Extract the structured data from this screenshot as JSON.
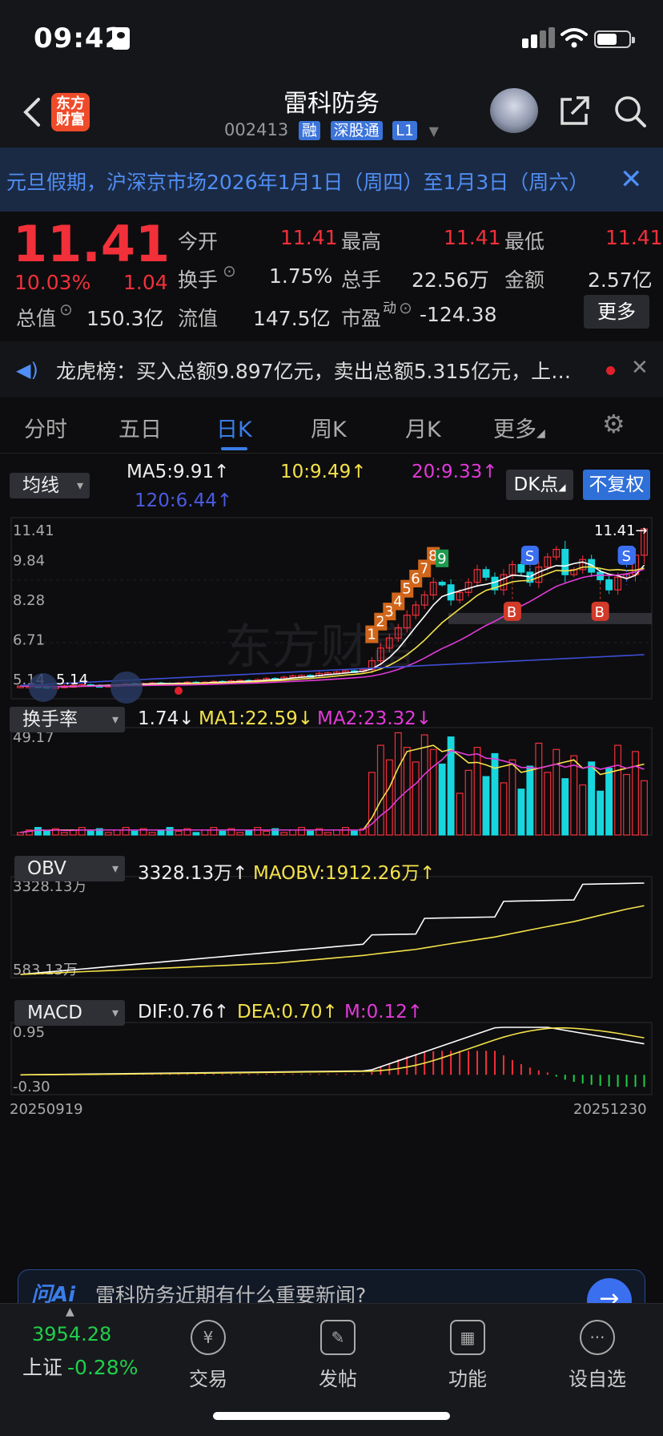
{
  "status_bar": {
    "time": "09:42"
  },
  "header": {
    "logo_text": "东方财富",
    "title": "雷科防务",
    "code": "002413",
    "tags": [
      "融",
      "深股通",
      "L1"
    ]
  },
  "notice": {
    "text": "元旦假期，沪深京市场2026年1月1日（周四）至1月3日（周六）"
  },
  "quote": {
    "price": "11.41",
    "change_pct": "10.03%",
    "change": "1.04",
    "open_label": "今开",
    "open": "11.41",
    "high_label": "最高",
    "high": "11.41",
    "low_label": "最低",
    "low": "11.41",
    "turnover_label": "换手",
    "turnover": "1.75%",
    "volume_label": "总手",
    "volume": "22.56万",
    "amount_label": "金额",
    "amount": "2.57亿",
    "mcap_label": "总值",
    "mcap": "150.3亿",
    "float_label": "流值",
    "float_cap": "147.5亿",
    "pe_label": "市盈",
    "pe_sup": "动",
    "pe": "-124.38",
    "more_label": "更多"
  },
  "dragon_tiger": {
    "text": "龙虎榜：买入总额9.897亿元，卖出总额5.315亿元，上榜原因..."
  },
  "tabs": [
    "分时",
    "五日",
    "日K",
    "周K",
    "月K",
    "更多"
  ],
  "active_tab": "日K",
  "kline": {
    "indicator_select": "均线",
    "ma5": "MA5:9.91↑",
    "ma10": "10:9.49↑",
    "ma20": "20:9.33↑",
    "ma120": "120:6.44↑",
    "dk_label": "DK点",
    "adjust_label": "不复权",
    "y_ticks": [
      "11.41",
      "9.84",
      "8.28",
      "6.71",
      "5.14"
    ],
    "last_label": "11.41",
    "low_marker": "5.14",
    "watermark": "东方财富",
    "signals": [
      "1",
      "2",
      "3",
      "4",
      "5",
      "6",
      "7",
      "8",
      "9"
    ],
    "s_marks": [
      "S",
      "S"
    ],
    "b_marks": [
      "B",
      "B"
    ]
  },
  "turnover": {
    "select": "换手率",
    "value": "1.74↓",
    "ma1": "MA1:22.59↓",
    "ma2": "MA2:23.32↓",
    "max": "49.17"
  },
  "obv": {
    "select": "OBV",
    "value": "3328.13万↑",
    "maobv": "MAOBV:1912.26万↑",
    "max": "3328.13万",
    "min": "583.13万"
  },
  "macd": {
    "select": "MACD",
    "dif": "DIF:0.76↑",
    "dea": "DEA:0.70↑",
    "m": "M:0.12↑",
    "max": "0.95",
    "min": "-0.30",
    "date_start": "20250919",
    "date_end": "20251230"
  },
  "chart_data": {
    "type": "candlestick",
    "x_range": [
      "20250919",
      "20251230"
    ],
    "ylim": [
      5.14,
      11.41
    ],
    "close_approx": [
      5.2,
      5.2,
      5.18,
      5.15,
      5.16,
      5.2,
      5.22,
      5.25,
      5.22,
      5.2,
      5.23,
      5.25,
      5.3,
      5.28,
      5.3,
      5.32,
      5.3,
      5.28,
      5.32,
      5.35,
      5.33,
      5.35,
      5.38,
      5.35,
      5.4,
      5.42,
      5.4,
      5.45,
      5.5,
      5.48,
      5.55,
      5.6,
      5.62,
      5.6,
      5.7,
      5.72,
      5.75,
      5.8,
      5.78,
      5.85,
      6.2,
      6.7,
      7.1,
      7.5,
      8.0,
      8.4,
      8.8,
      9.3,
      9.2,
      8.6,
      8.9,
      9.3,
      9.8,
      9.5,
      9.0,
      9.6,
      10.0,
      9.7,
      9.3,
      9.9,
      10.3,
      10.6,
      9.6,
      9.8,
      10.2,
      9.7,
      9.4,
      9.0,
      9.5,
      9.6,
      10.37,
      11.41
    ],
    "last": 11.41
  },
  "ai_bar": {
    "logo": "问Ai",
    "question": "雷科防务近期有什么重要新闻?"
  },
  "bottom_bar": {
    "index_value": "3954.28",
    "index_name": "上证",
    "index_change": "-0.28%",
    "items": [
      "交易",
      "发帖",
      "功能",
      "设自选"
    ]
  }
}
